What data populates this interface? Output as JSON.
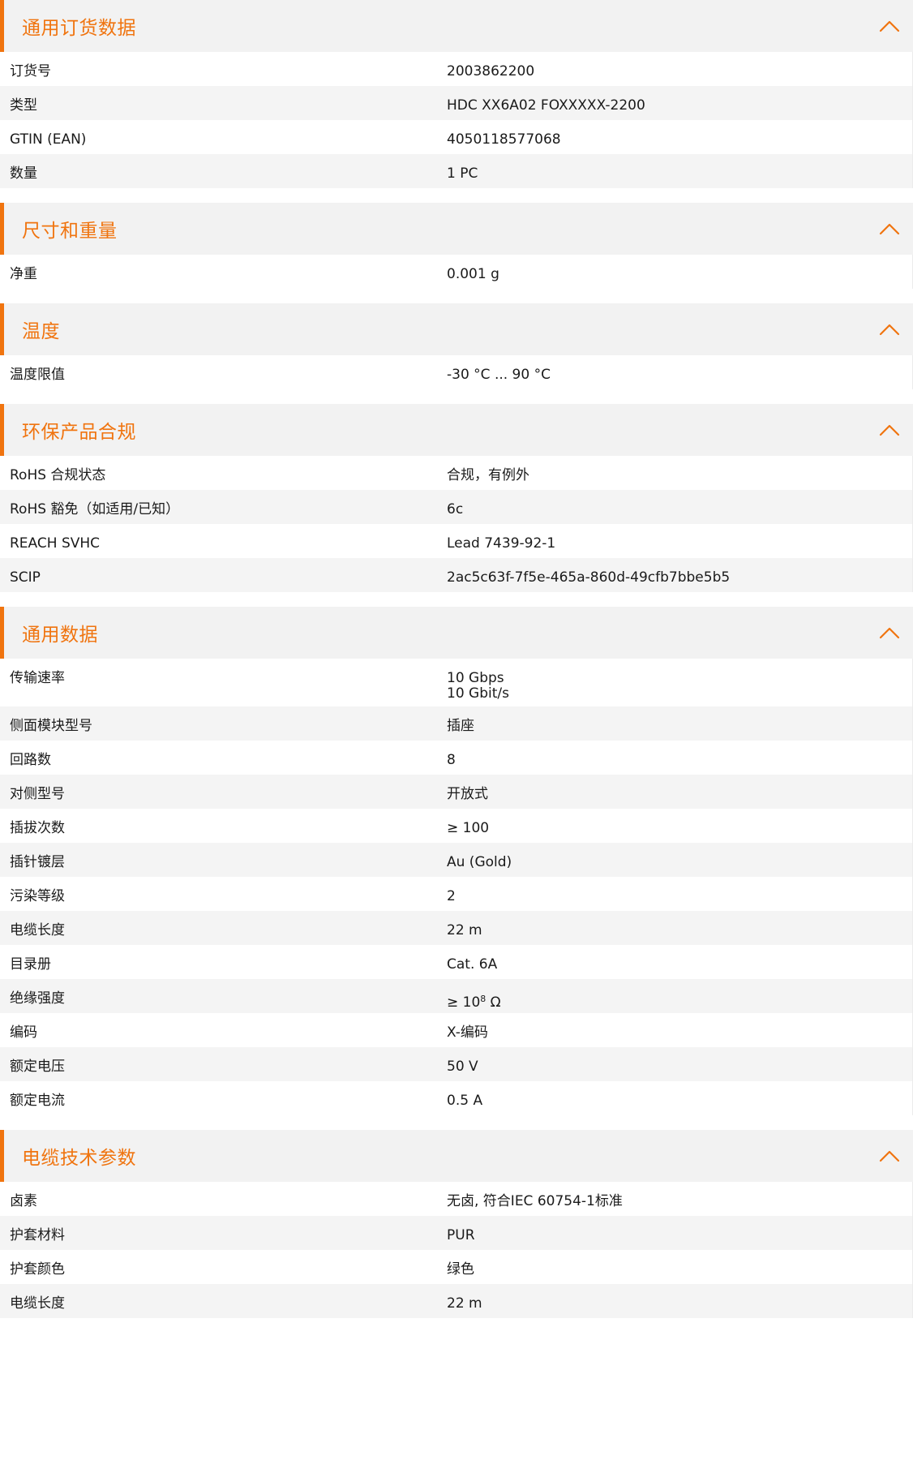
{
  "accent_color": "#f0740f",
  "sections": [
    {
      "title": "通用订货数据",
      "icon": "chevron-up-icon",
      "rows": [
        {
          "label": "订货号",
          "value": "2003862200"
        },
        {
          "label": "类型",
          "value": "HDC XX6A02 FOXXXXX-2200"
        },
        {
          "label": "GTIN (EAN)",
          "value": "4050118577068"
        },
        {
          "label": "数量",
          "value": "1  PC"
        }
      ]
    },
    {
      "title": "尺寸和重量",
      "icon": "chevron-up-icon",
      "rows": [
        {
          "label": "净重",
          "value": "0.001  g"
        }
      ]
    },
    {
      "title": "温度",
      "icon": "chevron-up-icon",
      "rows": [
        {
          "label": "温度限值",
          "value": "-30 °C ... 90 °C"
        }
      ]
    },
    {
      "title": "环保产品合规",
      "icon": "chevron-up-icon",
      "rows": [
        {
          "label": "RoHS 合规状态",
          "value": "合规，有例外"
        },
        {
          "label": "RoHS 豁免（如适用/已知）",
          "value": "6c"
        },
        {
          "label": "REACH SVHC",
          "value": "Lead 7439-92-1"
        },
        {
          "label": "SCIP",
          "value": "2ac5c63f-7f5e-465a-860d-49cfb7bbe5b5"
        }
      ]
    },
    {
      "title": "通用数据",
      "icon": "chevron-up-icon",
      "rows": [
        {
          "label": "传输速率",
          "value": "10 Gbps\n10 Gbit/s"
        },
        {
          "label": "侧面模块型号",
          "value": "插座"
        },
        {
          "label": "回路数",
          "value": "8"
        },
        {
          "label": "对侧型号",
          "value": "开放式"
        },
        {
          "label": "插拔次数",
          "value": "≥ 100"
        },
        {
          "label": "插针镀层",
          "value": "Au (Gold)"
        },
        {
          "label": "污染等级",
          "value": "2"
        },
        {
          "label": "电缆长度",
          "value": "22  m"
        },
        {
          "label": "目录册",
          "value": "Cat. 6A"
        },
        {
          "label": "绝缘强度",
          "value": "≥ 10",
          "value_sup": "8",
          "value_suffix": " Ω"
        },
        {
          "label": "编码",
          "value": "X-编码"
        },
        {
          "label": "额定电压",
          "value": "50  V"
        },
        {
          "label": "额定电流",
          "value": "0.5  A"
        }
      ]
    },
    {
      "title": "电缆技术参数",
      "icon": "chevron-up-icon",
      "rows": [
        {
          "label": "卤素",
          "value": "无卤, 符合IEC 60754-1标准"
        },
        {
          "label": "护套材料",
          "value": "PUR"
        },
        {
          "label": "护套颜色",
          "value": "绿色"
        },
        {
          "label": "电缆长度",
          "value": "22  m"
        }
      ]
    }
  ]
}
